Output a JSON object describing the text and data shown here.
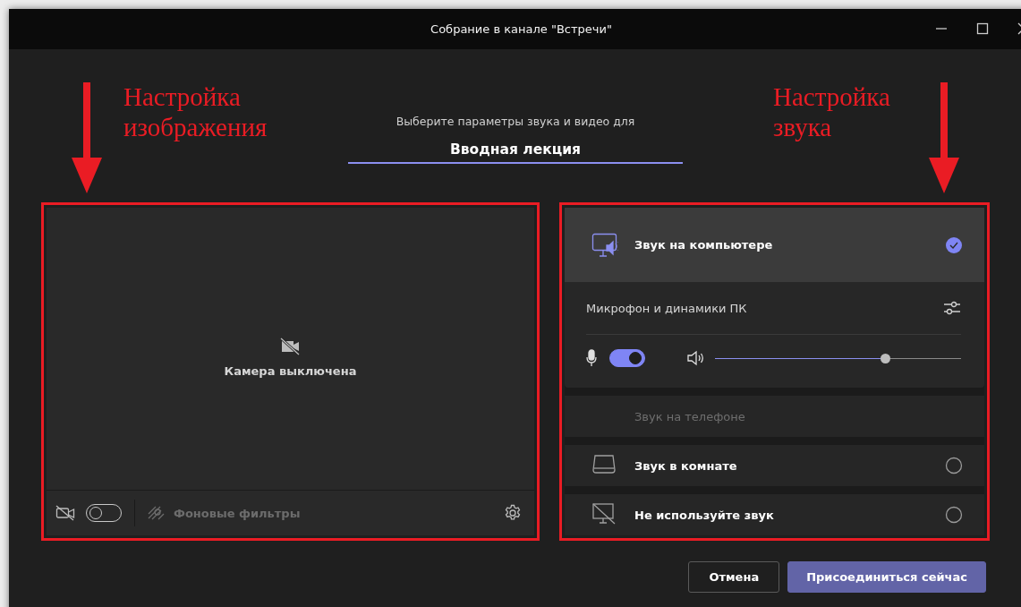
{
  "window": {
    "title": "Собрание в канале \"Встречи\""
  },
  "annotations": [
    {
      "text": "Настройка изображения"
    },
    {
      "text": "Настройка звука"
    }
  ],
  "header": {
    "prompt": "Выберите параметры звука и видео для",
    "meeting_name": "Вводная лекция"
  },
  "video": {
    "status": "Камера выключена",
    "camera_on": false,
    "filters_label": "Фоновые фильтры",
    "filters_disabled": true
  },
  "audio_options": [
    {
      "kind": "computer",
      "label": "Звук на компьютере",
      "selected": true,
      "disabled": false,
      "device": {
        "label": "Микрофон и динамики ПК",
        "mic_on": true,
        "level": 0.69
      }
    },
    {
      "kind": "phone",
      "label": "Звук на телефоне",
      "selected": false,
      "disabled": true
    },
    {
      "kind": "room",
      "label": "Звук в комнате",
      "selected": false,
      "disabled": false
    },
    {
      "kind": "none",
      "label": "Не используйте звук",
      "selected": false,
      "disabled": false
    }
  ],
  "buttons": [
    {
      "label": "Отмена",
      "kind": "secondary"
    },
    {
      "label": "Присоединиться сейчас",
      "kind": "primary"
    }
  ]
}
